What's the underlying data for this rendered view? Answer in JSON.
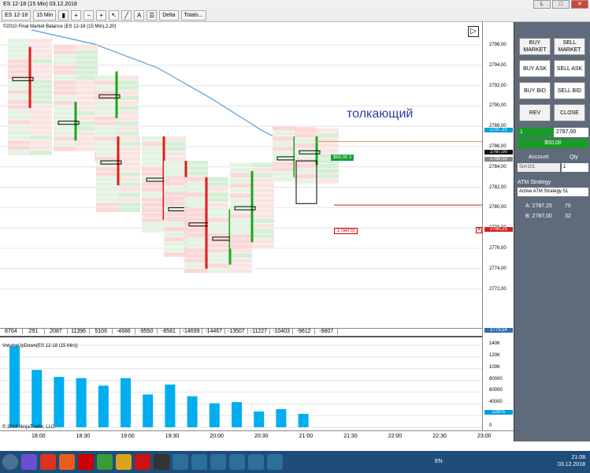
{
  "window": {
    "title": "ES 12-18 (15 Min)  03.12.2018",
    "btn_min": "L",
    "btn_max": "□",
    "btn_close": "✕"
  },
  "toolbar": {
    "instrument": "ES 12-18",
    "interval": "15 Min",
    "indicator": "Delta",
    "totals": "Totals..."
  },
  "chart": {
    "header": "©2010 Final Market Balance  (ES 12-18 (15 Min),2,20)",
    "annotation": "толкающий",
    "order_label": "1  Sell St",
    "position_label": "$50,00",
    "position_qty": "2",
    "ask_tag": "2787,25",
    "bid_tag": "2786,50",
    "order_tag": "2780,25",
    "last_tag": "2787,00",
    "low_tag": "2773,54",
    "price_ticks": [
      "2796,00",
      "2794,00",
      "2792,00",
      "2790,00",
      "2788,00",
      "2786,00",
      "2784,00",
      "2782,00",
      "2780,00",
      "2778,00",
      "2776,00",
      "2774,00",
      "2772,00"
    ],
    "deltas": [
      "8704",
      "291",
      "2087",
      "11396",
      "5106",
      "-4686",
      "-9550",
      "-8581",
      "-14699",
      "-14467",
      "-13507",
      "-11227",
      "-10403",
      "-9612",
      "-9807"
    ]
  },
  "volchart": {
    "title": "VolumeUpDown(ES 12-18 (15 Min))",
    "copyright": "© 2018 NinjaTrader, LLC",
    "last_tag": "22975",
    "ticks": [
      "140K",
      "120K",
      "100K",
      "80000",
      "60000",
      "40000",
      "20000",
      "0"
    ]
  },
  "time_axis": [
    "18:00",
    "18:30",
    "19:00",
    "19:30",
    "20:00",
    "20:30",
    "21:00",
    "21:30",
    "22:00",
    "22:30",
    "23:00"
  ],
  "chart_data": {
    "type": "bar",
    "title": "VolumeUpDown(ES 12-18 (15 Min))",
    "x": [
      "17:45",
      "18:00",
      "18:15",
      "18:30",
      "18:45",
      "19:00",
      "19:15",
      "19:30",
      "19:45",
      "20:00",
      "20:15",
      "20:30",
      "20:45",
      "21:00"
    ],
    "values": [
      138000,
      98000,
      86000,
      84000,
      71000,
      84000,
      56000,
      73000,
      53000,
      41000,
      43000,
      27000,
      31000,
      23000
    ],
    "ylim": [
      0,
      140000
    ]
  },
  "panel": {
    "buy_market": "BUY MARKET",
    "sell_market": "SELL MARKET",
    "buy_ask": "BUY ASK",
    "sell_ask": "SELL ASK",
    "buy_bid": "BUY BID",
    "sell_bid": "SELL BID",
    "rev": "REV",
    "close": "CLOSE",
    "qty_value": "1",
    "price_value": "2787,00",
    "pnl": "$50,00",
    "account_label": "Account",
    "qty_label": "Qty",
    "account_value": "Sim101",
    "qty_field": "1",
    "atm_label": "ATM Strategy",
    "atm_value": "Active ATM Strategy 51",
    "ask_line": "A: 2787,25",
    "ask_size": "70",
    "bid_line": "B: 2787,00",
    "bid_size": "32"
  },
  "taskbar": {
    "lang": "EN",
    "time": "21:08",
    "date": "03.12.2018"
  }
}
